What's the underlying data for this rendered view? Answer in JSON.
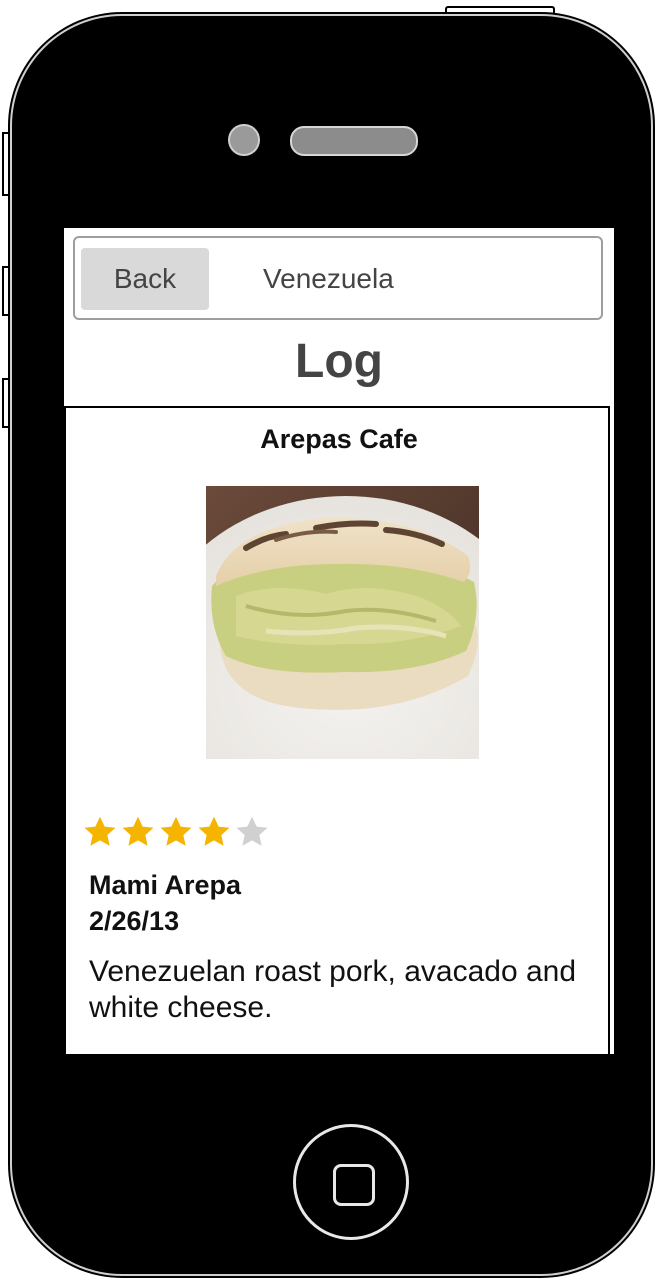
{
  "nav": {
    "back_label": "Back",
    "title": "Venezuela"
  },
  "page": {
    "title": "Log"
  },
  "entry": {
    "restaurant": "Arepas Cafe",
    "photo_icon": "arepa-photo",
    "rating": 4,
    "rating_max": 5,
    "item_name": "Mami Arepa",
    "date": "2/26/13",
    "description": "Venezuelan roast pork, avacado and white cheese."
  },
  "colors": {
    "star_filled": "#f5b400",
    "star_empty": "#d0d0d0",
    "nav_button_bg": "#d9d9d9",
    "text_dark": "#444444"
  }
}
